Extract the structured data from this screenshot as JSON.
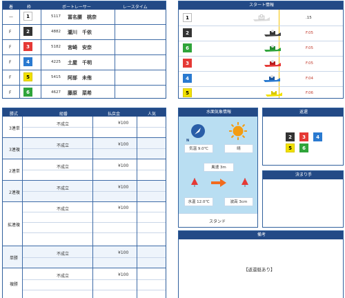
{
  "racers": {
    "headers": {
      "chaku": "着",
      "waku": "枠",
      "racer": "ボートレーサー",
      "time": "レースタイム"
    },
    "rows": [
      {
        "chaku": "—",
        "waku": "1",
        "id": "5117",
        "name": "冨名腰　桃奈",
        "time": ""
      },
      {
        "chaku": "F",
        "waku": "2",
        "id": "4882",
        "name": "瀧川　千依",
        "time": ""
      },
      {
        "chaku": "F",
        "waku": "3",
        "id": "5182",
        "name": "宮崎　安奈",
        "time": ""
      },
      {
        "chaku": "F",
        "waku": "4",
        "id": "4225",
        "name": "土屋　千明",
        "time": ""
      },
      {
        "chaku": "F",
        "waku": "5",
        "id": "5415",
        "name": "阿部　未侑",
        "time": ""
      },
      {
        "chaku": "F",
        "waku": "6",
        "id": "4627",
        "name": "藤原　菜希",
        "time": ""
      }
    ]
  },
  "start": {
    "title": "スタート情報",
    "rows": [
      {
        "waku": "1",
        "timing": ".15"
      },
      {
        "waku": "2",
        "timing": "F.05"
      },
      {
        "waku": "6",
        "timing": "F.05"
      },
      {
        "waku": "3",
        "timing": "F.05"
      },
      {
        "waku": "4",
        "timing": "F.04"
      },
      {
        "waku": "5",
        "timing": "F.06"
      }
    ]
  },
  "payout": {
    "headers": {
      "type": "勝式",
      "combo": "組番",
      "amount": "払戻金",
      "pop": "人気"
    },
    "groups": [
      {
        "type": "3連単",
        "combo": "不成立",
        "amount": "¥100"
      },
      {
        "type": "3連複",
        "combo": "不成立",
        "amount": "¥100"
      },
      {
        "type": "2連単",
        "combo": "不成立",
        "amount": "¥100"
      },
      {
        "type": "2連複",
        "combo": "不成立",
        "amount": "¥100"
      },
      {
        "type": "拡連複",
        "combo": "不成立",
        "amount": "¥100"
      },
      {
        "type": "単勝",
        "combo": "不成立",
        "amount": "¥100"
      },
      {
        "type": "複勝",
        "combo": "不成立",
        "amount": "¥100"
      }
    ]
  },
  "weather": {
    "title": "水面気象情報",
    "compass": "N",
    "temp": "気温 9.0℃",
    "cond": "晴",
    "wind": "風速 3m",
    "water": "水温 12.0℃",
    "wave": "波高 3cm",
    "stand": "スタンド"
  },
  "refund": {
    "title": "返還",
    "boats": [
      "2",
      "3",
      "4",
      "5",
      "6"
    ]
  },
  "kimarite": {
    "title": "決まり手",
    "value": ""
  },
  "bikou": {
    "title": "備考",
    "value": "【返還艇あり】"
  },
  "colors": {
    "header": "#234a86",
    "water": "#b9def2"
  }
}
